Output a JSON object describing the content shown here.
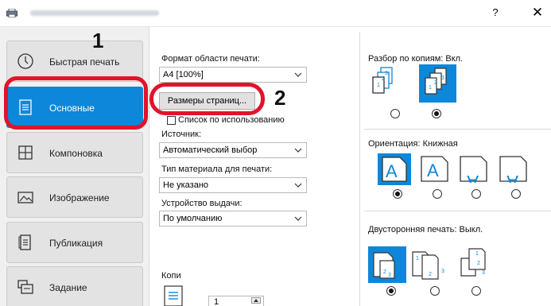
{
  "window": {
    "help": "?",
    "close": "✕"
  },
  "sidebar": {
    "items": [
      {
        "label": "Быстрая печать",
        "icon": "clock-icon"
      },
      {
        "label": "Основные",
        "icon": "document-icon"
      },
      {
        "label": "Компоновка",
        "icon": "layout-grid-icon"
      },
      {
        "label": "Изображение",
        "icon": "image-icon"
      },
      {
        "label": "Публикация",
        "icon": "publication-icon"
      },
      {
        "label": "Задание",
        "icon": "job-icon"
      }
    ],
    "active_index": 1
  },
  "callouts": {
    "one": "1",
    "two": "2"
  },
  "main": {
    "print_area_label": "Формат области печати:",
    "print_area_value": "A4  [100%]",
    "page_size_button": "Размеры страниц...",
    "use_list_checkbox": "Список по использованию",
    "source_label": "Источник:",
    "source_value": "Автоматический выбор",
    "media_type_label": "Тип материала для печати:",
    "media_type_value": "Не указано",
    "output_label": "Устройство выдачи:",
    "output_value": "По умолчанию",
    "copies_label": "Копи",
    "copies_value": "1"
  },
  "right": {
    "collate_label": "Разбор по копиям:",
    "collate_value": "Вкл.",
    "orientation_label": "Ориентация:",
    "orientation_value": "Книжная",
    "duplex_label": "Двусторонняя печать:",
    "duplex_value": "Выкл."
  },
  "colors": {
    "accent": "#0d87d9",
    "callout": "#e0142a"
  }
}
